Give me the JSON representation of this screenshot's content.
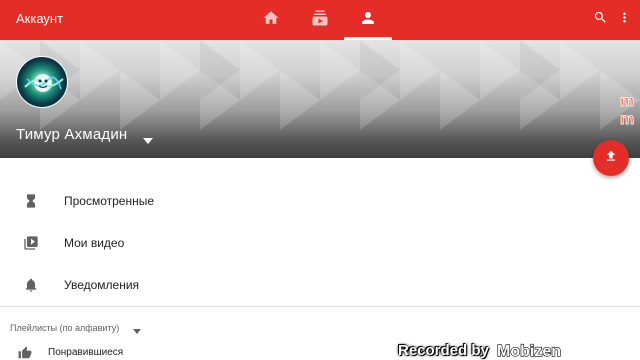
{
  "appbar": {
    "title": "Аккаунт",
    "tabs": [
      {
        "icon": "home-icon",
        "active": false
      },
      {
        "icon": "subscriptions-icon",
        "active": false
      },
      {
        "icon": "account-icon",
        "active": true
      }
    ],
    "actions": [
      "search-icon",
      "more-vert-icon"
    ],
    "color": "#e52d27"
  },
  "channel": {
    "name": "Тимур Ахмадин",
    "avatar_icon": "avatar-image"
  },
  "fab": {
    "icon": "upload-icon",
    "color": "#e52d27"
  },
  "menu": {
    "items": [
      {
        "label": "Просмотренные",
        "icon": "hourglass-icon"
      },
      {
        "label": "Мои видео",
        "icon": "my-videos-icon"
      },
      {
        "label": "Уведомления",
        "icon": "bell-icon"
      }
    ]
  },
  "playlists": {
    "header": "Плейлисты (по алфавиту)",
    "items": [
      {
        "label": "Понравившиеся",
        "icon": "thumb-up-icon"
      }
    ]
  },
  "watermark": {
    "text": "Recorded by",
    "brand": "Mobizen"
  }
}
